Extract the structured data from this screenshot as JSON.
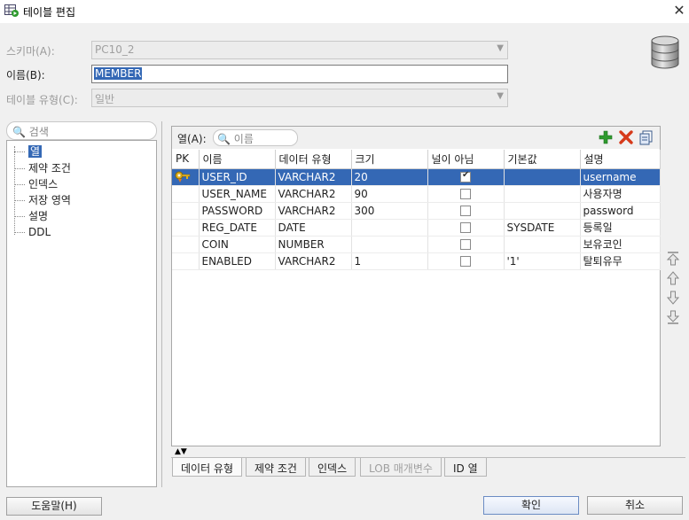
{
  "window": {
    "title": "테이블 편집",
    "close_glyph": "✕"
  },
  "form": {
    "schema_label": "스키마(A):",
    "schema_value": "PC10_2",
    "name_label": "이름(B):",
    "name_value": "MEMBER",
    "type_label": "테이블 유형(C):",
    "type_value": "일반"
  },
  "left_panel": {
    "search_placeholder": "검색",
    "items": [
      {
        "label": "열",
        "selected": true
      },
      {
        "label": "제약 조건"
      },
      {
        "label": "인덱스"
      },
      {
        "label": "저장 영역"
      },
      {
        "label": "설명"
      },
      {
        "label": "DDL"
      }
    ]
  },
  "columns_panel": {
    "label": "열(A):",
    "filter_placeholder": "이름",
    "icons": [
      "add-icon",
      "delete-icon",
      "copy-icon"
    ],
    "headers": [
      "PK",
      "이름",
      "데이터 유형",
      "크기",
      "널이 아님",
      "기본값",
      "설명"
    ],
    "rows": [
      {
        "pk": true,
        "name": "USER_ID",
        "type": "VARCHAR2",
        "size": "20",
        "not_null": true,
        "default": "",
        "desc": "username",
        "selected": true
      },
      {
        "pk": false,
        "name": "USER_NAME",
        "type": "VARCHAR2",
        "size": "90",
        "not_null": false,
        "default": "",
        "desc": "사용자명"
      },
      {
        "pk": false,
        "name": "PASSWORD",
        "type": "VARCHAR2",
        "size": "300",
        "not_null": false,
        "default": "",
        "desc": "password"
      },
      {
        "pk": false,
        "name": "REG_DATE",
        "type": "DATE",
        "size": "",
        "not_null": false,
        "default": "SYSDATE",
        "desc": "등록일"
      },
      {
        "pk": false,
        "name": "COIN",
        "type": "NUMBER",
        "size": "",
        "not_null": false,
        "default": "",
        "desc": "보유코인"
      },
      {
        "pk": false,
        "name": "ENABLED",
        "type": "VARCHAR2",
        "size": "1",
        "not_null": false,
        "default": "'1'",
        "desc": "탈퇴유무"
      }
    ]
  },
  "tabs": [
    {
      "label": "데이터 유형",
      "active": true
    },
    {
      "label": "제약 조건"
    },
    {
      "label": "인덱스"
    },
    {
      "label": "LOB 매개변수",
      "disabled": true
    },
    {
      "label": "ID 열"
    }
  ],
  "footer": {
    "help": "도움말(H)",
    "ok": "확인",
    "cancel": "취소"
  },
  "colors": {
    "selection": "#3468b5",
    "add": "#2e9a2e",
    "delete": "#d63a1a"
  }
}
